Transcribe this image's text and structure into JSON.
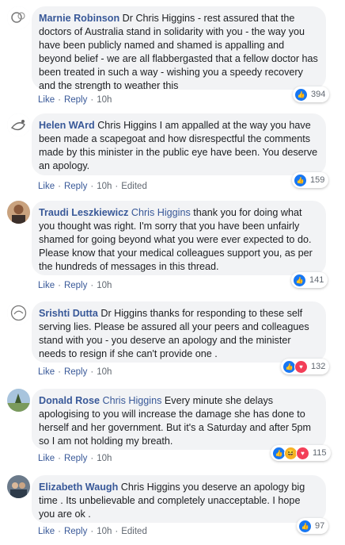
{
  "comments": [
    {
      "author": "Marnie Robinson",
      "mention": "",
      "text": "Dr Chris Higgins - rest assured that the doctors of Australia stand in solidarity with you - the way you have been publicly named and shamed is appalling and beyond belief - we are all flabbergasted that a fellow doctor has been treated in such a way - wishing you a speedy recovery and the strength to weather this",
      "like": "Like",
      "reply": "Reply",
      "time": "10h",
      "edited": "",
      "reactions": [
        "like"
      ],
      "count": "394"
    },
    {
      "author": "Helen WArd",
      "mention": "",
      "text": "Chris Higgins I am appalled at the way you have been made a scapegoat and how disrespectful the comments made by this minister in the public eye have been. You deserve an apology.",
      "like": "Like",
      "reply": "Reply",
      "time": "10h",
      "edited": "Edited",
      "reactions": [
        "like"
      ],
      "count": "159"
    },
    {
      "author": "Traudi Leszkiewicz",
      "mention": "Chris Higgins",
      "text": "thank you for doing what you thought was right. I'm sorry that you have been unfairly shamed for going beyond what you were ever expected to do. Please know that your medical colleagues support you, as per the hundreds of messages in this thread.",
      "like": "Like",
      "reply": "Reply",
      "time": "10h",
      "edited": "",
      "reactions": [
        "like"
      ],
      "count": "141"
    },
    {
      "author": "Srishti Dutta",
      "mention": "",
      "text": "Dr Higgins thanks for responding to these self serving lies. Please be assured all your peers and colleagues stand with you - you deserve an apology and the minister needs to resign if she can't provide one .",
      "like": "Like",
      "reply": "Reply",
      "time": "10h",
      "edited": "",
      "reactions": [
        "like",
        "love"
      ],
      "count": "132"
    },
    {
      "author": "Donald Rose",
      "mention": "Chris Higgins",
      "text": "Every minute she delays apologising to you will increase the damage she has done to herself and her government. But it's a Saturday and after 5pm so I am not holding my breath.",
      "like": "Like",
      "reply": "Reply",
      "time": "10h",
      "edited": "",
      "reactions": [
        "like",
        "haha",
        "love"
      ],
      "count": "115"
    },
    {
      "author": "Elizabeth Waugh",
      "mention": "",
      "text": "Chris Higgins you deserve an apology big time . Its unbelievable and completely unacceptable. I hope you are ok .",
      "like": "Like",
      "reply": "Reply",
      "time": "10h",
      "edited": "Edited",
      "reactions": [
        "like"
      ],
      "count": "97"
    }
  ],
  "colors": {
    "link": "#385898",
    "bubble": "#f2f3f5",
    "like": "#1877f2",
    "love": "#f33e58",
    "haha": "#f7b125"
  }
}
